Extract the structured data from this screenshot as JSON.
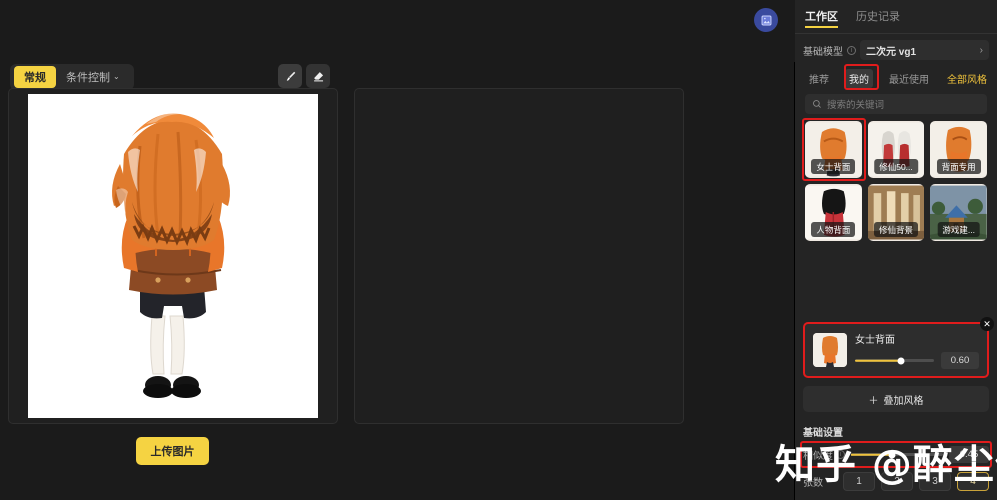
{
  "workspace": {
    "blue_button_icon": "image-upload-icon",
    "toolbar": {
      "segments": [
        {
          "label": "常规",
          "active": true
        },
        {
          "label": "条件控制",
          "active": false,
          "caret": "⌄"
        }
      ],
      "tools": [
        {
          "name": "brush-tool",
          "icon": "brush-icon"
        },
        {
          "name": "eraser-tool",
          "icon": "eraser-icon"
        }
      ]
    },
    "canvas": {
      "left_image_alt": "orange-haired anime character back view",
      "right_panel_empty": true
    },
    "upload_button_label": "上传图片"
  },
  "sidebar": {
    "tabs": [
      {
        "label": "工作区",
        "active": true
      },
      {
        "label": "历史记录",
        "active": false
      }
    ],
    "model": {
      "label": "基础模型",
      "info_icon": "info-icon",
      "value": "二次元 vg1",
      "chevron": "›"
    },
    "style_tabs": [
      {
        "label": "推荐",
        "selected": false
      },
      {
        "label": "我的",
        "selected": true
      },
      {
        "label": "最近使用",
        "selected": false
      }
    ],
    "all_styles_label": "全部风格",
    "search": {
      "icon": "search-icon",
      "placeholder": "搜索的关键词",
      "value": ""
    },
    "style_cards": [
      {
        "caption": "女士背面",
        "selected": true
      },
      {
        "caption": "修仙50...",
        "selected": false
      },
      {
        "caption": "背面专用",
        "selected": false
      },
      {
        "caption": "人物背面",
        "selected": false
      },
      {
        "caption": "修仙背景",
        "selected": false
      },
      {
        "caption": "游戏建...",
        "selected": false
      }
    ],
    "selected_style": {
      "name": "女士背面",
      "weight": "0.60",
      "weight_pct": 58,
      "close_icon": "close-icon"
    },
    "add_style_label": "叠加风格",
    "add_style_icon": "plus-icon",
    "basic_settings": {
      "title": "基础设置",
      "rows": [
        {
          "label": "相似度",
          "info_icon": "info-icon",
          "value": "0.45",
          "value_pct": 45
        }
      ],
      "count": {
        "label": "张数",
        "options": [
          "1",
          "2",
          "3",
          "4"
        ],
        "selected": "4"
      }
    }
  },
  "watermark": {
    "text": "知乎 @醉尘仙"
  },
  "colors": {
    "accent_yellow": "#f5d342",
    "highlight_red": "#e01c1c",
    "panel_bg": "#242424",
    "app_bg": "#1b1b1b"
  }
}
